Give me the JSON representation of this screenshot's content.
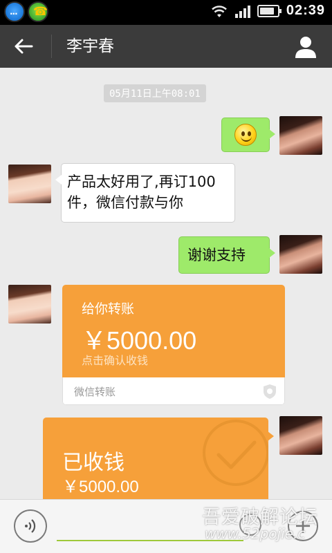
{
  "status_bar": {
    "notifications": [
      "qq-icon",
      "game-phone-icon"
    ],
    "clock": "02:39",
    "battery_level": 0.85
  },
  "title_bar": {
    "back_icon": "arrow-left-icon",
    "title": "李宇春",
    "profile_icon": "person-icon"
  },
  "chat": {
    "timestamp": "05月11日上午08:01",
    "messages": [
      {
        "from": "me",
        "type": "emoji",
        "emoji": "smiley-icon"
      },
      {
        "from": "contact",
        "type": "text",
        "line1": "产品太好用了,再订100",
        "line2": "件，微信付款与你"
      },
      {
        "from": "me",
        "type": "text",
        "text": "谢谢支持"
      },
      {
        "from": "contact",
        "type": "transfer",
        "title": "给你转账",
        "amount": "￥5000.00",
        "action": "点击确认收钱",
        "footer": "微信转账"
      },
      {
        "from": "me",
        "type": "received",
        "title": "已收钱",
        "amount": "￥5000.00"
      }
    ]
  },
  "input_bar": {
    "voice_icon": "voice-icon",
    "text_value": "",
    "plus_icon": "plus-icon"
  },
  "watermark": {
    "text": "吾爱破解论坛",
    "url": "www.52pojie.c"
  },
  "colors": {
    "bubble_green": "#9eea6a",
    "transfer_orange": "#f6a03a",
    "title_bar": "#3b3b3b"
  }
}
